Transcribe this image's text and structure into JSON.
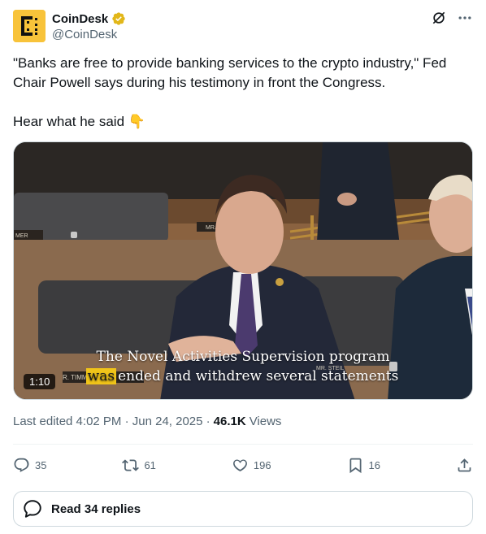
{
  "account": {
    "display_name": "CoinDesk",
    "handle": "@CoinDesk",
    "verified_color": "#e2b719"
  },
  "tweet": {
    "text": "\"Banks are free to provide banking services to the crypto industry,\" Fed Chair Powell says during his testimony in front the Congress.",
    "text2": "Hear what he said",
    "emoji": "👇"
  },
  "video": {
    "caption_line1": "The Novel Activities Supervision program",
    "caption_highlight": "was",
    "caption_line2_rest": "ended and withdrew several statements",
    "duration": "1:10",
    "nameplate_left": "MER",
    "nameplate_center": "MR. LO",
    "nameplate_timmons": "R. TIMMONS",
    "nameplate_steil": "MR. STEIL"
  },
  "meta": {
    "edited_label": "Last edited 4:02 PM · Jun 24, 2025 ·",
    "views_count": "46.1K",
    "views_label": "Views"
  },
  "actions": {
    "replies": "35",
    "reposts": "61",
    "likes": "196",
    "bookmarks": "16"
  },
  "read_replies": "Read 34 replies",
  "icons": [
    "grok-icon",
    "more-icon",
    "reply-icon",
    "repost-icon",
    "like-icon",
    "bookmark-icon",
    "share-icon",
    "speech-bubble-icon",
    "verified-badge-icon"
  ]
}
